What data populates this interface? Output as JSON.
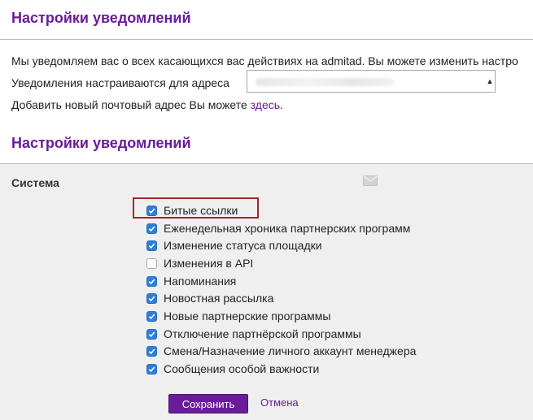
{
  "header": {
    "title": "Настройки уведомлений"
  },
  "intro": {
    "text": "Мы уведомляем вас о всех касающихся вас действиях на admitad. Вы можете изменить настро"
  },
  "email": {
    "label": "Уведомления настраиваются для адреса",
    "selected_value": ""
  },
  "add_email": {
    "text": "Добавить новый почтовый адрес Вы можете ",
    "link": "здесь",
    "suffix": "."
  },
  "settings": {
    "title": "Настройки уведомлений",
    "section": "Система",
    "channel_icon": "mail-icon",
    "options": [
      {
        "label": "Битые ссылки",
        "checked": true,
        "highlighted": true
      },
      {
        "label": "Еженедельная хроника партнерских программ",
        "checked": true
      },
      {
        "label": "Изменение статуса площадки",
        "checked": true
      },
      {
        "label": "Изменения в API",
        "checked": false
      },
      {
        "label": "Напоминания",
        "checked": true
      },
      {
        "label": "Новостная рассылка",
        "checked": true
      },
      {
        "label": "Новые партнерские программы",
        "checked": true
      },
      {
        "label": "Отключение партнёрской программы",
        "checked": true
      },
      {
        "label": "Смена/Назначение личного аккаунт менеджера",
        "checked": true
      },
      {
        "label": "Сообщения особой важности",
        "checked": true
      }
    ]
  },
  "actions": {
    "save": "Сохранить",
    "cancel": "Отмена"
  },
  "colors": {
    "accent": "#6a1b9a",
    "checkbox": "#2f7fd8",
    "highlight": "#a3262a",
    "panel": "#efefef"
  }
}
